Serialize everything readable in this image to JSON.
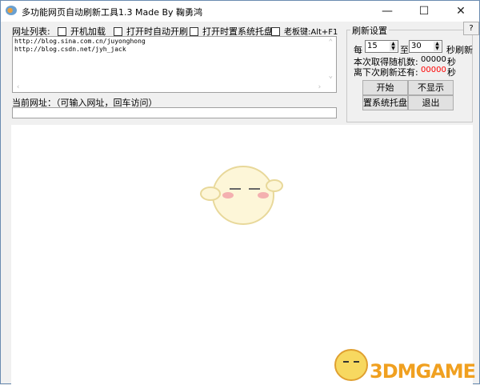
{
  "window": {
    "title": "多功能网页自动刷新工具1.3 Made By 鞠勇鸿",
    "minimize": "—",
    "maximize": "☐",
    "close": "✕"
  },
  "options": {
    "url_list_label": "网址列表:",
    "startup": "开机加载",
    "auto_refresh": "打开时自动开刷",
    "tray_on_open": "打开时置系统托盘",
    "boss_key": "老板键:Alt+F1"
  },
  "urls": [
    "http://blog.sina.com.cn/juyonghong",
    "http://blog.csdn.net/jyh_jack"
  ],
  "current_url": {
    "label": "当前网址：（可输入网址，回车访问）",
    "value": ""
  },
  "settings": {
    "title": "刷新设置",
    "help": "?",
    "every": "每",
    "from": "15",
    "to_label": "至",
    "to": "30",
    "sec_refresh": "秒刷新",
    "random_label": "本次取得随机数:",
    "random_value": "00000",
    "sec": "秒",
    "next_label": "离下次刷新还有:",
    "next_value": "00000",
    "next_color": "#ff0000"
  },
  "buttons": {
    "start": "开始",
    "hide": "不显示",
    "tray": "置系统托盘",
    "exit": "退出"
  },
  "watermark": "3DMGAME"
}
